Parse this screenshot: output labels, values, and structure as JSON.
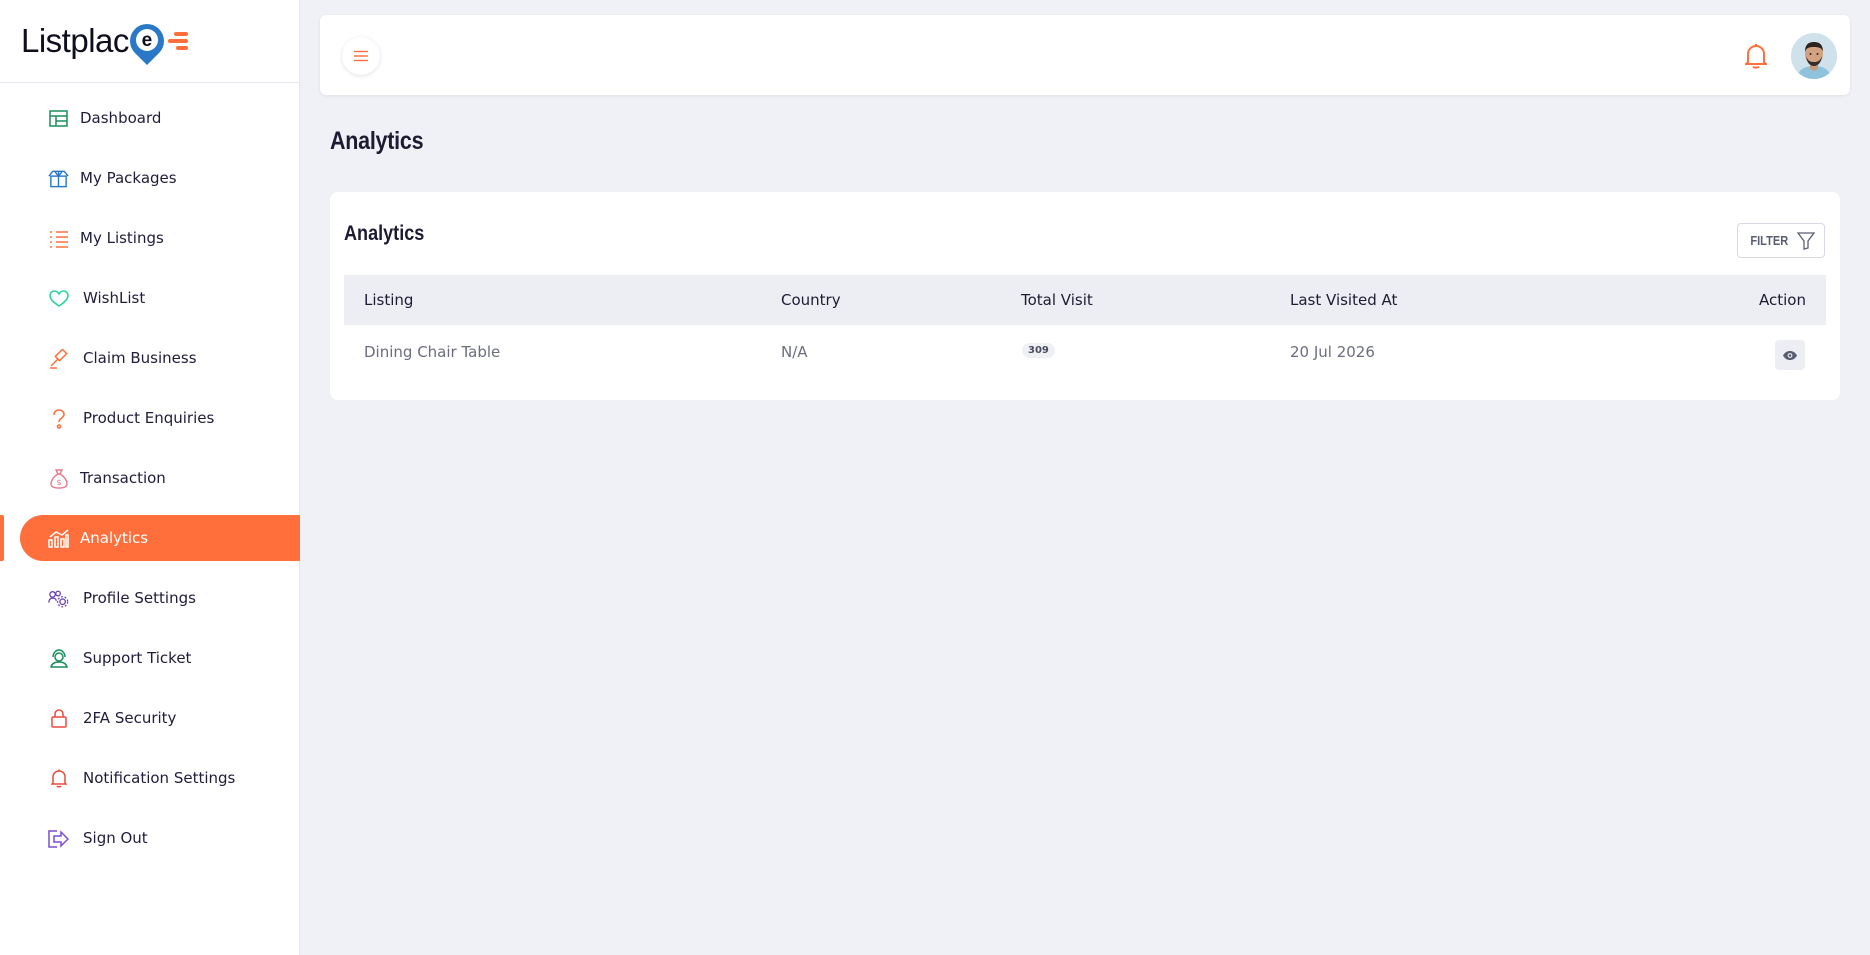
{
  "brand": {
    "name": "Listplac",
    "mark_letter": "e"
  },
  "sidebar": {
    "items": [
      {
        "label": "Dashboard",
        "icon": "grid-icon",
        "color": "#1a8f5a",
        "active": false
      },
      {
        "label": "My Packages",
        "icon": "box-icon",
        "color": "#2a78c8",
        "active": false
      },
      {
        "label": "My Listings",
        "icon": "list-icon",
        "color": "#ff6f3c",
        "active": false
      },
      {
        "label": "WishList",
        "icon": "heart-icon",
        "color": "#2dd4a0",
        "active": false
      },
      {
        "label": "Claim Business",
        "icon": "gavel-icon",
        "color": "#ff6f3c",
        "active": false
      },
      {
        "label": "Product Enquiries",
        "icon": "question-icon",
        "color": "#ff6f3c",
        "active": false
      },
      {
        "label": "Transaction",
        "icon": "money-bag-icon",
        "color": "#e8788a",
        "active": false
      },
      {
        "label": "Analytics",
        "icon": "analytics-icon",
        "color": "#ffffff",
        "active": true
      },
      {
        "label": "Profile Settings",
        "icon": "user-gear-icon",
        "color": "#6a3fb5",
        "active": false
      },
      {
        "label": "Support Ticket",
        "icon": "headset-icon",
        "color": "#1a8f5a",
        "active": false
      },
      {
        "label": "2FA Security",
        "icon": "lock-icon",
        "color": "#e84c3d",
        "active": false
      },
      {
        "label": "Notification Settings",
        "icon": "bell-icon",
        "color": "#e84c3d",
        "active": false
      },
      {
        "label": "Sign Out",
        "icon": "sign-out-icon",
        "color": "#7b4fd0",
        "active": false
      }
    ]
  },
  "header": {
    "accent": "#ff6f3c"
  },
  "page": {
    "title": "Analytics"
  },
  "card": {
    "title": "Analytics",
    "filter_label": "FILTER",
    "columns": [
      "Listing",
      "Country",
      "Total Visit",
      "Last Visited At",
      "Action"
    ],
    "rows": [
      {
        "listing": "Dining Chair Table",
        "country": "N/A",
        "total_visit": "309",
        "last_visited": "20 Jul 2026"
      }
    ]
  }
}
